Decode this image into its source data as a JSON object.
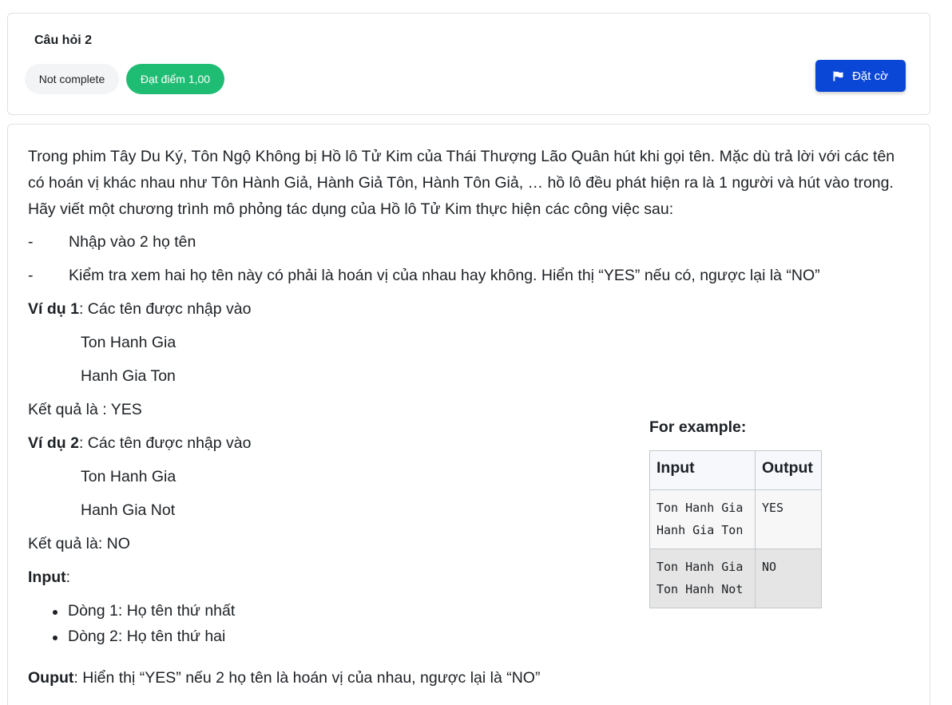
{
  "header": {
    "question_title": "Câu hỏi 2",
    "state_badge": "Not complete",
    "grade_badge": "Đạt điểm 1,00",
    "flag_button": "Đặt cờ",
    "colors": {
      "grade_badge": "#1fbd73",
      "flag_button": "#0b47d6"
    }
  },
  "content": {
    "intro": "Trong phim Tây Du Ký, Tôn Ngộ Không bị Hồ lô Tử Kim của Thái Thượng Lão Quân hút khi gọi tên. Mặc dù trả lời với các tên có hoán vị khác nhau như Tôn Hành Giả, Hành Giả Tôn, Hành Tôn Giả, … hồ lô đều phát hiện ra là 1 người và hút vào trong. Hãy viết một chương trình mô phỏng tác dụng của Hồ lô Tử Kim thực hiện các công việc sau:",
    "tasks": [
      {
        "dash": "-",
        "text": "Nhập vào 2 họ tên"
      },
      {
        "dash": "-",
        "text": "Kiểm tra xem hai họ tên này có phải là hoán vị của nhau hay không. Hiển thị “YES” nếu có, ngược lại là “NO”"
      }
    ],
    "example1": {
      "label": "Ví dụ 1",
      "desc": ": Các tên được nhập vào",
      "names": [
        "Ton Hanh Gia",
        "Hanh Gia Ton"
      ],
      "result": "Kết quả là : YES"
    },
    "example2": {
      "label": "Ví dụ 2",
      "desc": ": Các tên được nhập vào",
      "names": [
        "Ton Hanh Gia",
        "Hanh Gia Not"
      ],
      "result": "Kết quả là: NO"
    },
    "input_section": {
      "label": "Input",
      "suffix": ":",
      "items": [
        "Dòng 1: Họ tên thứ nhất",
        "Dòng 2: Họ tên thứ hai"
      ]
    },
    "output_section": {
      "label": "Ouput",
      "text": ": Hiển thị “YES” nếu 2 họ tên là hoán vị của nhau, ngược lại là “NO”"
    }
  },
  "examples_table": {
    "heading": "For example:",
    "columns": [
      "Input",
      "Output"
    ],
    "rows": [
      {
        "input": [
          "Ton Hanh Gia",
          "Hanh Gia Ton"
        ],
        "output": "YES"
      },
      {
        "input": [
          "Ton Hanh Gia",
          "Ton Hanh Not"
        ],
        "output": "NO"
      }
    ]
  }
}
